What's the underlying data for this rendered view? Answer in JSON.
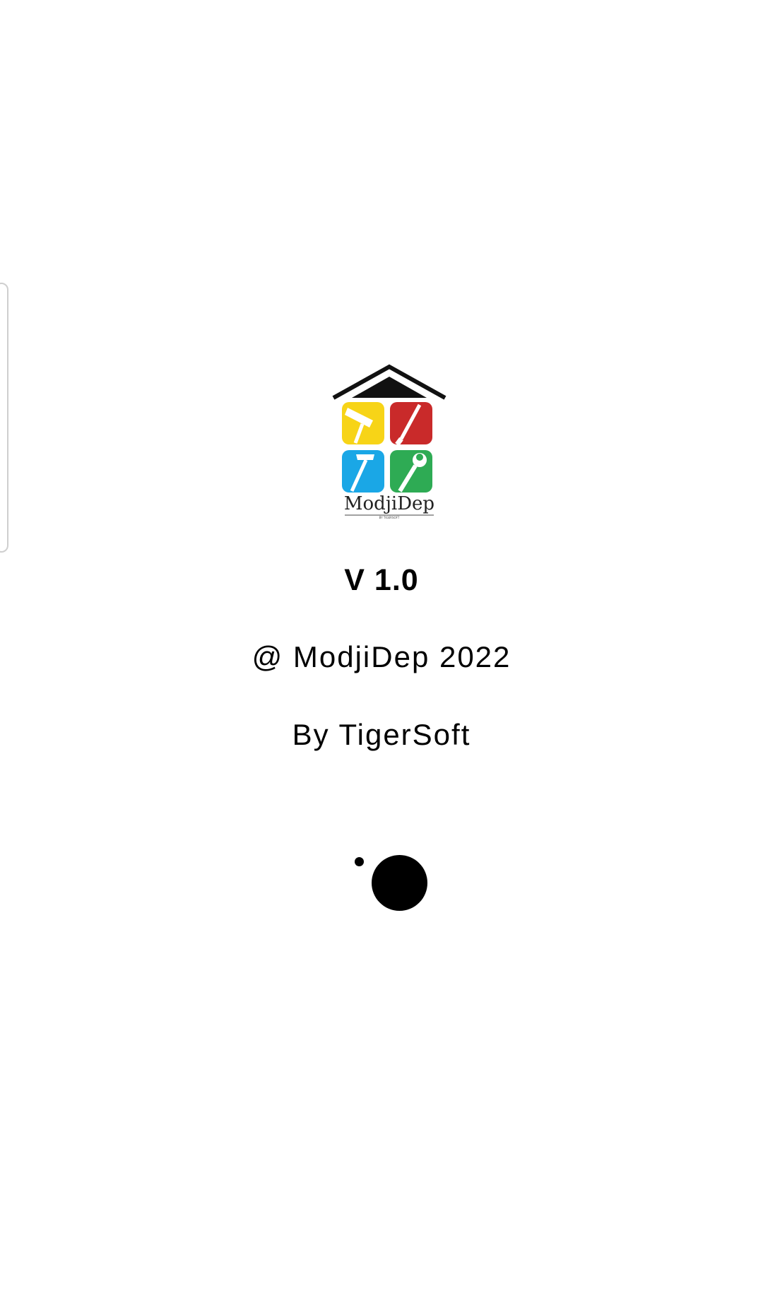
{
  "splash": {
    "logo": {
      "name": "modjidep-house-tools-logo",
      "wordmark": "ModjiDep",
      "tagline": "BY TIGERSOFT",
      "colors": {
        "roof": "#111111",
        "yellow": "#f7d417",
        "red": "#c92a2a",
        "blue": "#1aa7e6",
        "green": "#2eab54"
      }
    },
    "version": "V 1.0",
    "copyright": "@ ModjiDep 2022",
    "author": "By TigerSoft",
    "loader_icon": "loading-dots-icon"
  }
}
